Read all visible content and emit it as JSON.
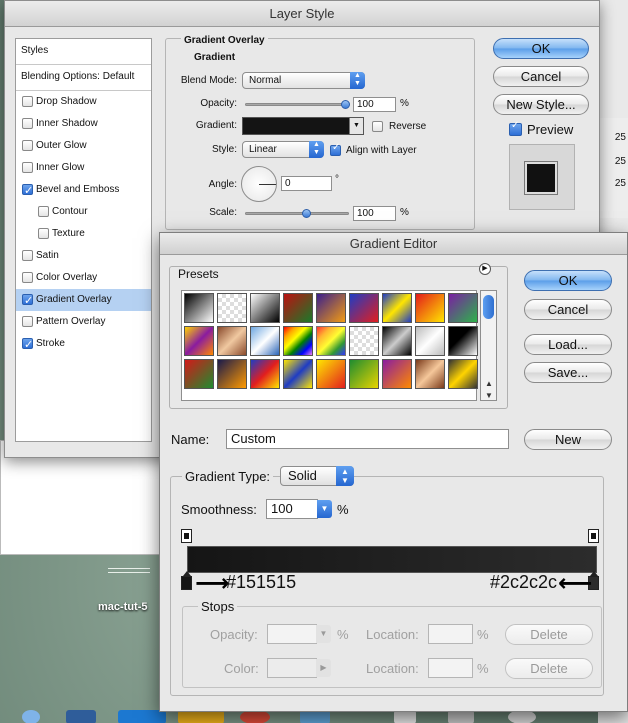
{
  "desktop": {
    "caption": "mac-tut-5"
  },
  "layer_style": {
    "title": "Layer Style",
    "styles_header": "Styles",
    "blending_options": "Blending Options: Default",
    "style_items": [
      {
        "label": "Drop Shadow",
        "checked": false
      },
      {
        "label": "Inner Shadow",
        "checked": false
      },
      {
        "label": "Outer Glow",
        "checked": false
      },
      {
        "label": "Inner Glow",
        "checked": false
      },
      {
        "label": "Bevel and Emboss",
        "checked": true
      },
      {
        "label": "Contour",
        "checked": false
      },
      {
        "label": "Texture",
        "checked": false
      },
      {
        "label": "Satin",
        "checked": false
      },
      {
        "label": "Color Overlay",
        "checked": false
      },
      {
        "label": "Gradient Overlay",
        "checked": true,
        "selected": true
      },
      {
        "label": "Pattern Overlay",
        "checked": false
      },
      {
        "label": "Stroke",
        "checked": true
      }
    ],
    "panel_title": "Gradient Overlay",
    "section_title": "Gradient",
    "blend_mode_label": "Blend Mode:",
    "blend_mode_value": "Normal",
    "opacity_label": "Opacity:",
    "opacity_value": "100",
    "gradient_label": "Gradient:",
    "reverse_label": "Reverse",
    "style_label": "Style:",
    "style_value": "Linear",
    "align_label": "Align with Layer",
    "angle_label": "Angle:",
    "angle_value": "0",
    "angle_unit": "°",
    "scale_label": "Scale:",
    "scale_value": "100",
    "percent": "%",
    "ok": "OK",
    "cancel": "Cancel",
    "new_style": "New Style...",
    "preview": "Preview",
    "bg_values": [
      "25",
      "25",
      "25"
    ]
  },
  "gradient_editor": {
    "title": "Gradient Editor",
    "presets_label": "Presets",
    "ok": "OK",
    "cancel": "Cancel",
    "load": "Load...",
    "save": "Save...",
    "name_label": "Name:",
    "name_value": "Custom",
    "new": "New",
    "gradient_type_label": "Gradient Type:",
    "gradient_type_value": "Solid",
    "smoothness_label": "Smoothness:",
    "smoothness_value": "100",
    "percent": "%",
    "left_color": "#151515",
    "right_color": "#2c2c2c",
    "stops_label": "Stops",
    "opacity_label": "Opacity:",
    "color_label": "Color:",
    "location_label": "Location:",
    "delete": "Delete"
  },
  "colors": {
    "accent": "#3b7ddd",
    "selected_row": "#b5d1f2"
  }
}
